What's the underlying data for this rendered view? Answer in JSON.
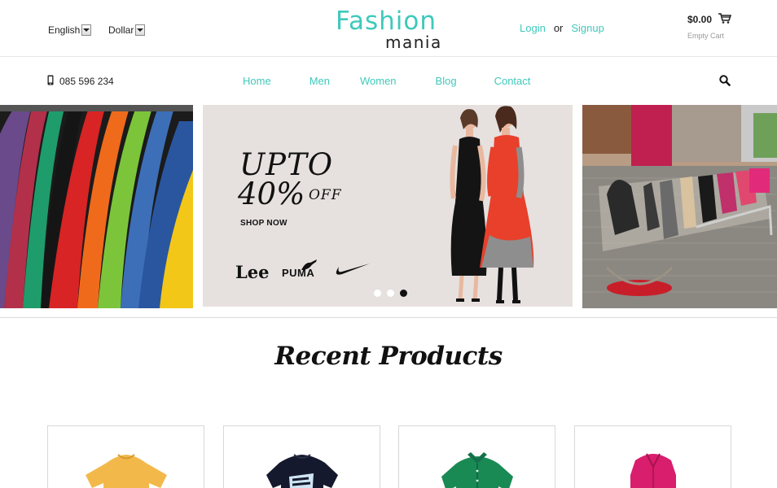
{
  "header": {
    "language": "English",
    "currency": "Dollar",
    "logo_line1": "Fashion",
    "logo_line2": "mania",
    "login": "Login",
    "or": "or",
    "signup": "Signup",
    "cart_total": "$0.00",
    "cart_status": "Empty Cart"
  },
  "nav": {
    "phone": "085 596 234",
    "items": [
      {
        "label": "Home"
      },
      {
        "label": "Men"
      },
      {
        "label": "Women"
      },
      {
        "label": "Blog"
      },
      {
        "label": "Contact"
      }
    ]
  },
  "banner": {
    "promo_line1": "UPTO",
    "promo_line2": "40%",
    "promo_off": "OFF",
    "cta": "SHOP NOW",
    "brands": [
      "Lee",
      "PUMA"
    ],
    "slides_total": 3,
    "active_slide": 3
  },
  "section": {
    "title": "Recent Products"
  },
  "products": [
    {
      "name": "yellow-tshirt",
      "color": "#f2b94a"
    },
    {
      "name": "navy-graphic-tshirt",
      "color": "#15192e"
    },
    {
      "name": "green-shirt",
      "color": "#1a8a55"
    },
    {
      "name": "pink-cardigan",
      "color": "#d81e6d"
    }
  ],
  "colors": {
    "accent": "#3fc9bb",
    "text": "#222222"
  }
}
